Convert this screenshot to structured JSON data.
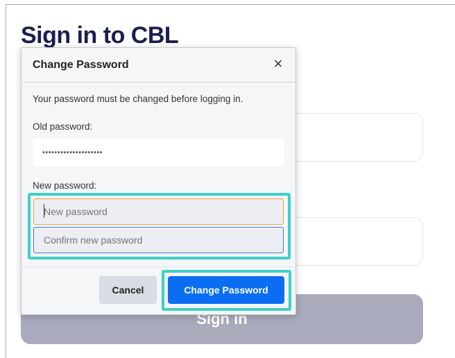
{
  "background": {
    "title": "Sign in to CBL",
    "signin_label": "Sign in"
  },
  "modal": {
    "title": "Change Password",
    "close_glyph": "×",
    "message": "Your password must be changed before logging in.",
    "old_password": {
      "label": "Old password:",
      "value": "••••••••••••••••••••"
    },
    "new_password": {
      "label": "New password:",
      "placeholder": "New password",
      "confirm_placeholder": "Confirm new password"
    },
    "buttons": {
      "cancel": "Cancel",
      "change": "Change Password"
    }
  },
  "colors": {
    "primary": "#0b6ef2",
    "highlight": "#3fd0c4",
    "focus_border": "#e6a33a",
    "title": "#1a1f4e"
  }
}
